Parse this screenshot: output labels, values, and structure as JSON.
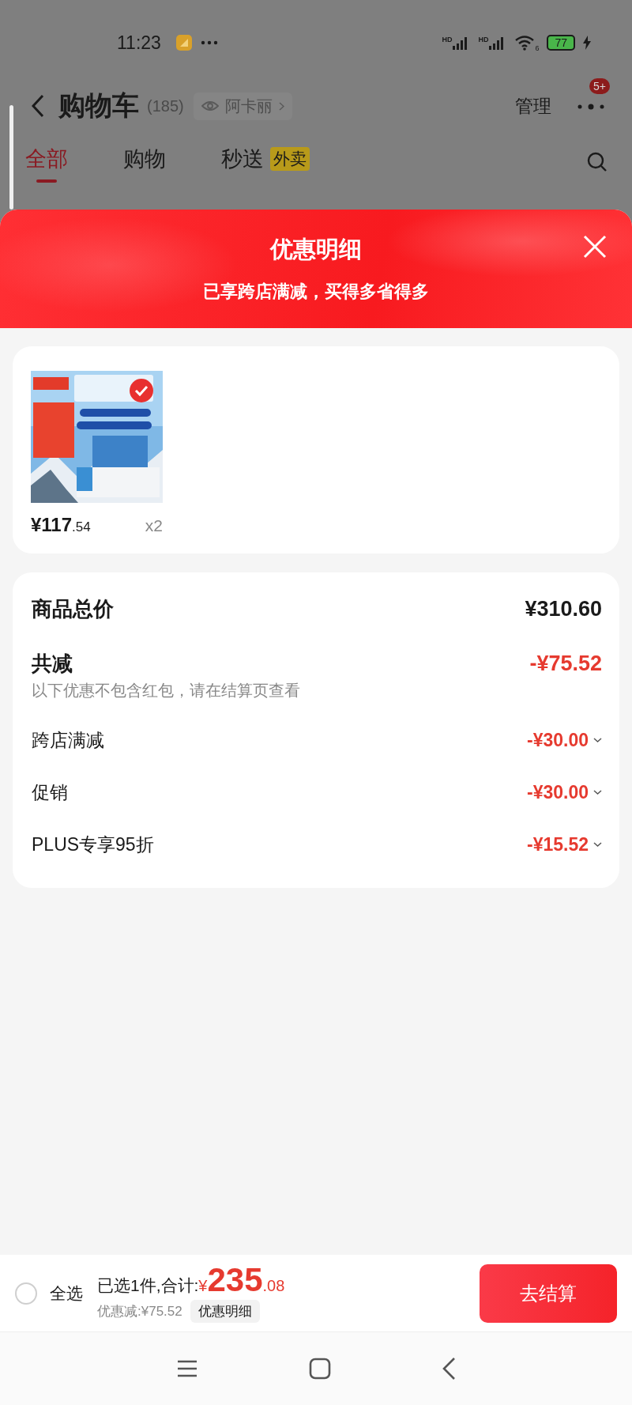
{
  "status_bar": {
    "time": "11:23",
    "signal_labels": [
      "HD",
      "HD"
    ],
    "wifi_label": "6",
    "battery": "77"
  },
  "header": {
    "title": "购物车",
    "count": "(185)",
    "viewer": "阿卡丽",
    "manage": "管理",
    "badge": "5+"
  },
  "tabs": [
    {
      "label": "全部",
      "selected": true
    },
    {
      "label": "购物",
      "selected": false
    },
    {
      "label": "秒送",
      "tag": "外卖",
      "selected": false
    }
  ],
  "sheet": {
    "title": "优惠明细",
    "subtitle": "已享跨店满减，买得多省得多"
  },
  "product": {
    "kind": "picture",
    "checked": true,
    "price_main": "¥117",
    "price_decimal": ".54",
    "quantity": "x2"
  },
  "summary": {
    "total_label": "商品总价",
    "total": "¥310.60",
    "discount_label": "共减",
    "discount": "-¥75.52",
    "note": "以下优惠不包含红包，请在结算页查看",
    "items": [
      {
        "label": "跨店满减",
        "amount": "-¥30.00"
      },
      {
        "label": "促销",
        "amount": "-¥30.00"
      },
      {
        "label": "PLUS专享95折",
        "amount": "-¥15.52"
      }
    ]
  },
  "bottom_bar": {
    "select_all": {
      "label": "全选",
      "checked": false
    },
    "summary_label": "已选1件,合计:",
    "currency": "¥",
    "total_main": "235",
    "total_decimal": ".08",
    "saving": "优惠减:¥75.52",
    "detail_button": "优惠明细",
    "checkout": "去结算"
  }
}
